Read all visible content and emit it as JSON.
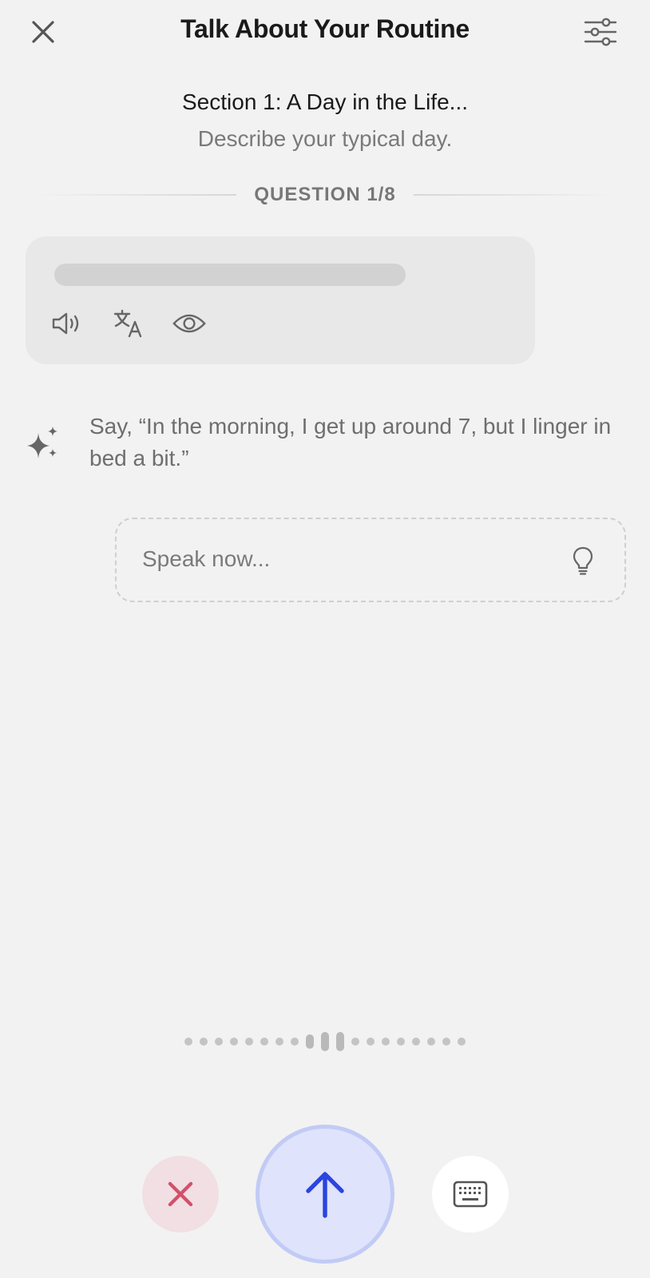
{
  "header": {
    "title": "Talk About Your Routine",
    "close_icon": "close-icon",
    "settings_icon": "sliders-icon"
  },
  "section": {
    "title": "Section 1: A Day in the Life...",
    "subtitle": "Describe your typical day."
  },
  "question": {
    "label": "QUESTION 1/8"
  },
  "prompt_card": {
    "icons": [
      "speaker-icon",
      "translate-icon",
      "eye-icon"
    ]
  },
  "hint": {
    "icon": "sparkle-icon",
    "text": "Say, “In the morning, I get up around 7, but I linger in bed a bit.”"
  },
  "speak_input": {
    "placeholder": "Speak now...",
    "hint_icon": "lightbulb-icon"
  },
  "controls": {
    "cancel_icon": "x-icon",
    "send_icon": "arrow-up-icon",
    "keyboard_icon": "keyboard-icon"
  },
  "colors": {
    "background": "#f2f2f2",
    "send_accent": "#2a44e0",
    "cancel_accent": "#d2506a",
    "muted_text": "#7a7a7a"
  }
}
